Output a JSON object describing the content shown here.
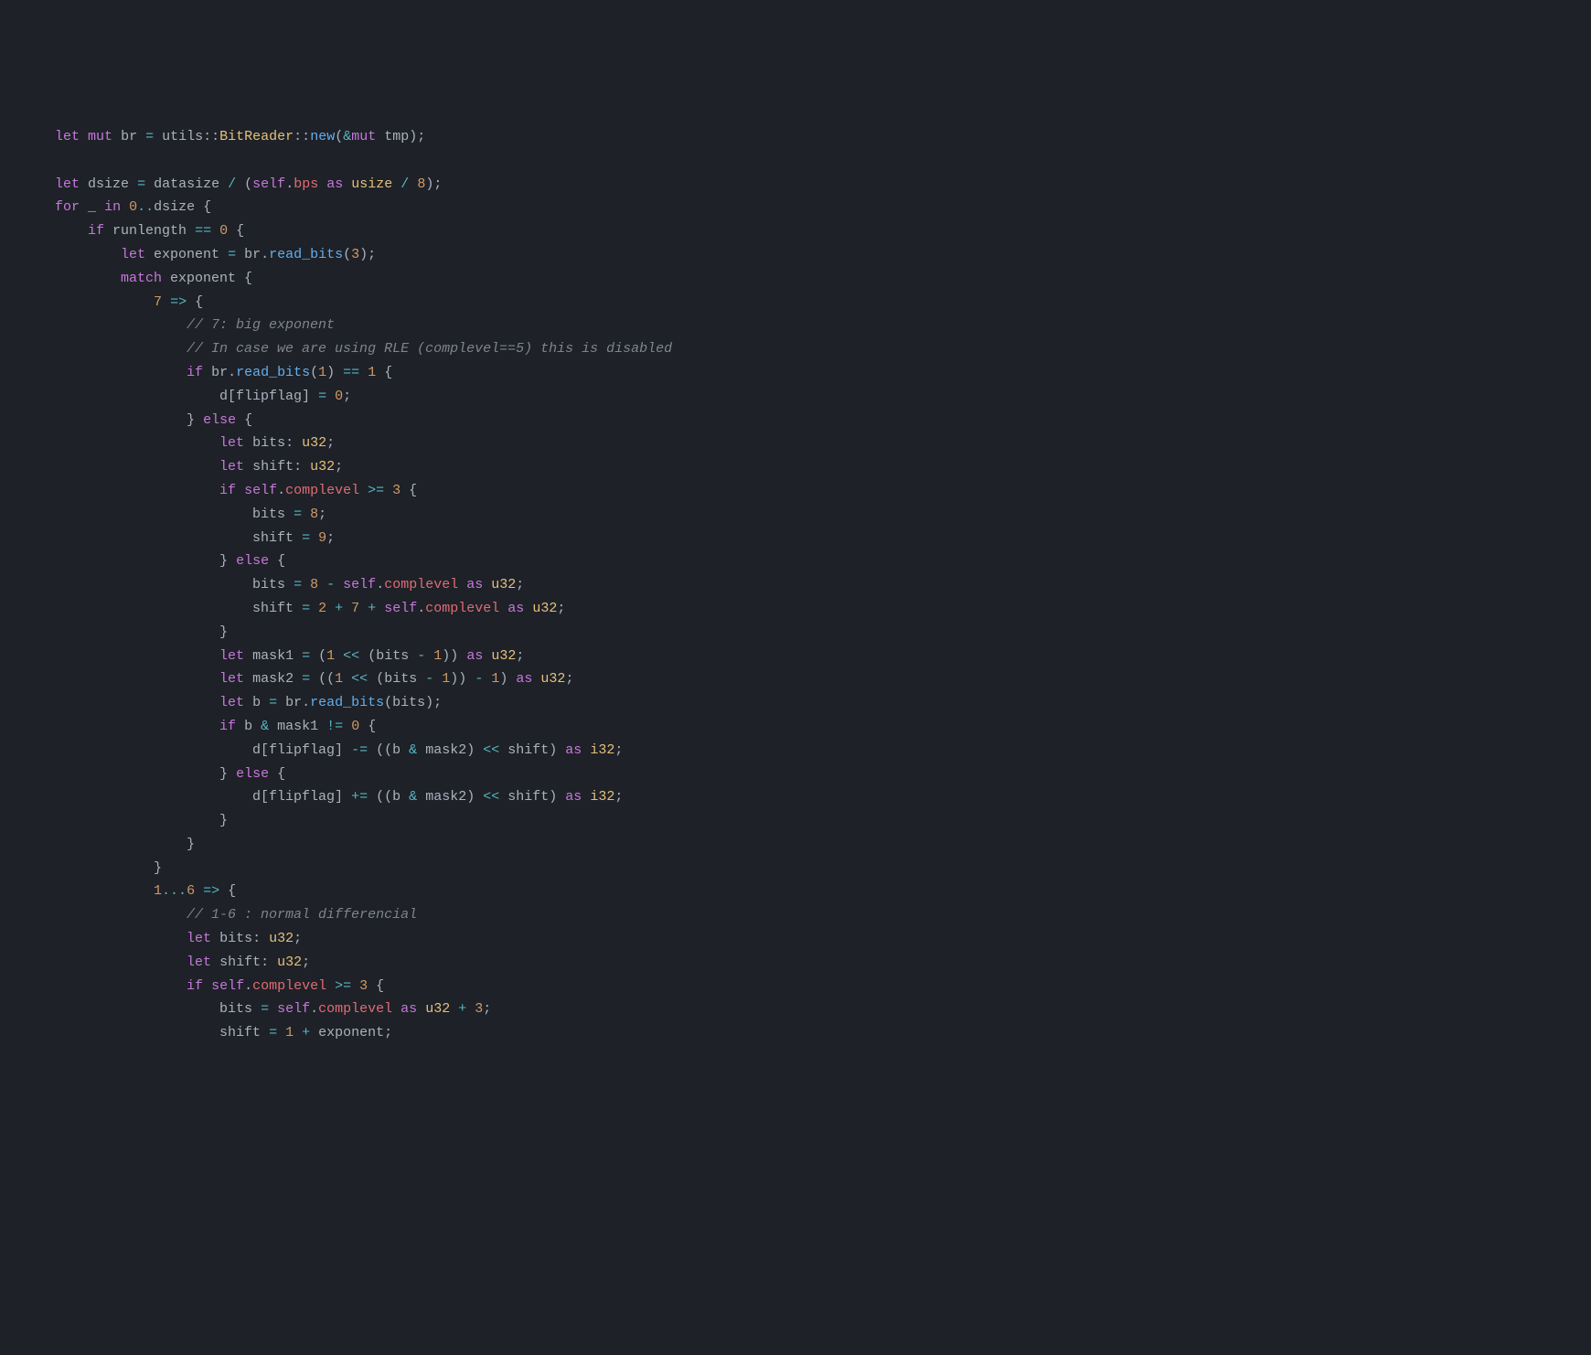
{
  "code": {
    "line1": {
      "t1": "let",
      "t2": "mut",
      "t3": "br",
      "t4": "=",
      "t5": "utils",
      "t6": "::",
      "t7": "BitReader",
      "t8": "::",
      "t9": "new",
      "t10": "(",
      "t11": "&",
      "t12": "mut",
      "t13": " tmp);"
    },
    "line2": {
      "t1": "let",
      "t2": "dsize",
      "t3": "=",
      "t4": "datasize",
      "t5": "/",
      "t6": "(",
      "t7": "self",
      "t8": ".",
      "t9": "bps",
      "t10": "as",
      "t11": "usize",
      "t12": "/",
      "t13": "8",
      "t14": ");"
    },
    "line3": {
      "t1": "for",
      "t2": "_",
      "t3": "in",
      "t4": "0",
      "t5": "..",
      "t6": "dsize {"
    },
    "line4": {
      "t1": "if",
      "t2": "runlength",
      "t3": "==",
      "t4": "0",
      "t5": " {"
    },
    "line5": {
      "t1": "let",
      "t2": "exponent",
      "t3": "=",
      "t4": "br.",
      "t5": "read_bits",
      "t6": "(",
      "t7": "3",
      "t8": ");"
    },
    "line6": {
      "t1": "match",
      "t2": "exponent {"
    },
    "line7": {
      "t1": "7",
      "t2": "=>",
      "t3": " {"
    },
    "line8": {
      "t1": "// 7: big exponent"
    },
    "line9": {
      "t1": "// In case we are using RLE (complevel==5) this is disabled"
    },
    "line10": {
      "t1": "if",
      "t2": "br.",
      "t3": "read_bits",
      "t4": "(",
      "t5": "1",
      "t6": ")",
      "t7": "==",
      "t8": "1",
      "t9": " {"
    },
    "line11": {
      "t1": "d[flipflag]",
      "t2": "=",
      "t3": "0",
      "t4": ";"
    },
    "line12": {
      "t1": "}",
      "t2": "else",
      "t3": " {"
    },
    "line13": {
      "t1": "let",
      "t2": "bits:",
      "t3": "u32",
      "t4": ";"
    },
    "line14": {
      "t1": "let",
      "t2": "shift:",
      "t3": "u32",
      "t4": ";"
    },
    "line15": {
      "t1": "if",
      "t2": "self",
      "t3": ".",
      "t4": "complevel",
      "t5": ">=",
      "t6": "3",
      "t7": " {"
    },
    "line16": {
      "t1": "bits",
      "t2": "=",
      "t3": "8",
      "t4": ";"
    },
    "line17": {
      "t1": "shift",
      "t2": "=",
      "t3": "9",
      "t4": ";"
    },
    "line18": {
      "t1": "}",
      "t2": "else",
      "t3": " {"
    },
    "line19": {
      "t1": "bits",
      "t2": "=",
      "t3": "8",
      "t4": "-",
      "t5": "self",
      "t6": ".",
      "t7": "complevel",
      "t8": "as",
      "t9": "u32",
      "t10": ";"
    },
    "line20": {
      "t1": "shift",
      "t2": "=",
      "t3": "2",
      "t4": "+",
      "t5": "7",
      "t6": "+",
      "t7": "self",
      "t8": ".",
      "t9": "complevel",
      "t10": "as",
      "t11": "u32",
      "t12": ";"
    },
    "line21": {
      "t1": "}"
    },
    "line22": {
      "t1": "let",
      "t2": "mask1",
      "t3": "=",
      "t4": "(",
      "t5": "1",
      "t6": "<<",
      "t7": "(bits",
      "t8": "-",
      "t9": "1",
      "t10": "))",
      "t11": "as",
      "t12": "u32",
      "t13": ";"
    },
    "line23": {
      "t1": "let",
      "t2": "mask2",
      "t3": "=",
      "t4": "((",
      "t5": "1",
      "t6": "<<",
      "t7": "(bits",
      "t8": "-",
      "t9": "1",
      "t10": "))",
      "t11": "-",
      "t12": "1",
      "t13": ")",
      "t14": "as",
      "t15": "u32",
      "t16": ";"
    },
    "line24": {
      "t1": "let",
      "t2": "b",
      "t3": "=",
      "t4": "br.",
      "t5": "read_bits",
      "t6": "(bits);"
    },
    "line25": {
      "t1": "if",
      "t2": "b",
      "t3": "&",
      "t4": "mask1",
      "t5": "!=",
      "t6": "0",
      "t7": " {"
    },
    "line26": {
      "t1": "d[flipflag]",
      "t2": "-=",
      "t3": "((b",
      "t4": "&",
      "t5": "mask2)",
      "t6": "<<",
      "t7": "shift)",
      "t8": "as",
      "t9": "i32",
      "t10": ";"
    },
    "line27": {
      "t1": "}",
      "t2": "else",
      "t3": " {"
    },
    "line28": {
      "t1": "d[flipflag]",
      "t2": "+=",
      "t3": "((b",
      "t4": "&",
      "t5": "mask2)",
      "t6": "<<",
      "t7": "shift)",
      "t8": "as",
      "t9": "i32",
      "t10": ";"
    },
    "line29": {
      "t1": "}"
    },
    "line30": {
      "t1": "}"
    },
    "line31": {
      "t1": "}"
    },
    "line32": {
      "t1": "1",
      "t2": "...",
      "t3": "6",
      "t4": "=>",
      "t5": " {"
    },
    "line33": {
      "t1": "// 1-6 : normal differencial"
    },
    "line34": {
      "t1": "let",
      "t2": "bits:",
      "t3": "u32",
      "t4": ";"
    },
    "line35": {
      "t1": "let",
      "t2": "shift:",
      "t3": "u32",
      "t4": ";"
    },
    "line36": {
      "t1": "if",
      "t2": "self",
      "t3": ".",
      "t4": "complevel",
      "t5": ">=",
      "t6": "3",
      "t7": " {"
    },
    "line37": {
      "t1": "bits",
      "t2": "=",
      "t3": "self",
      "t4": ".",
      "t5": "complevel",
      "t6": "as",
      "t7": "u32",
      "t8": "+",
      "t9": "3",
      "t10": ";"
    },
    "line38": {
      "t1": "shift",
      "t2": "=",
      "t3": "1",
      "t4": "+",
      "t5": "exponent;"
    }
  }
}
